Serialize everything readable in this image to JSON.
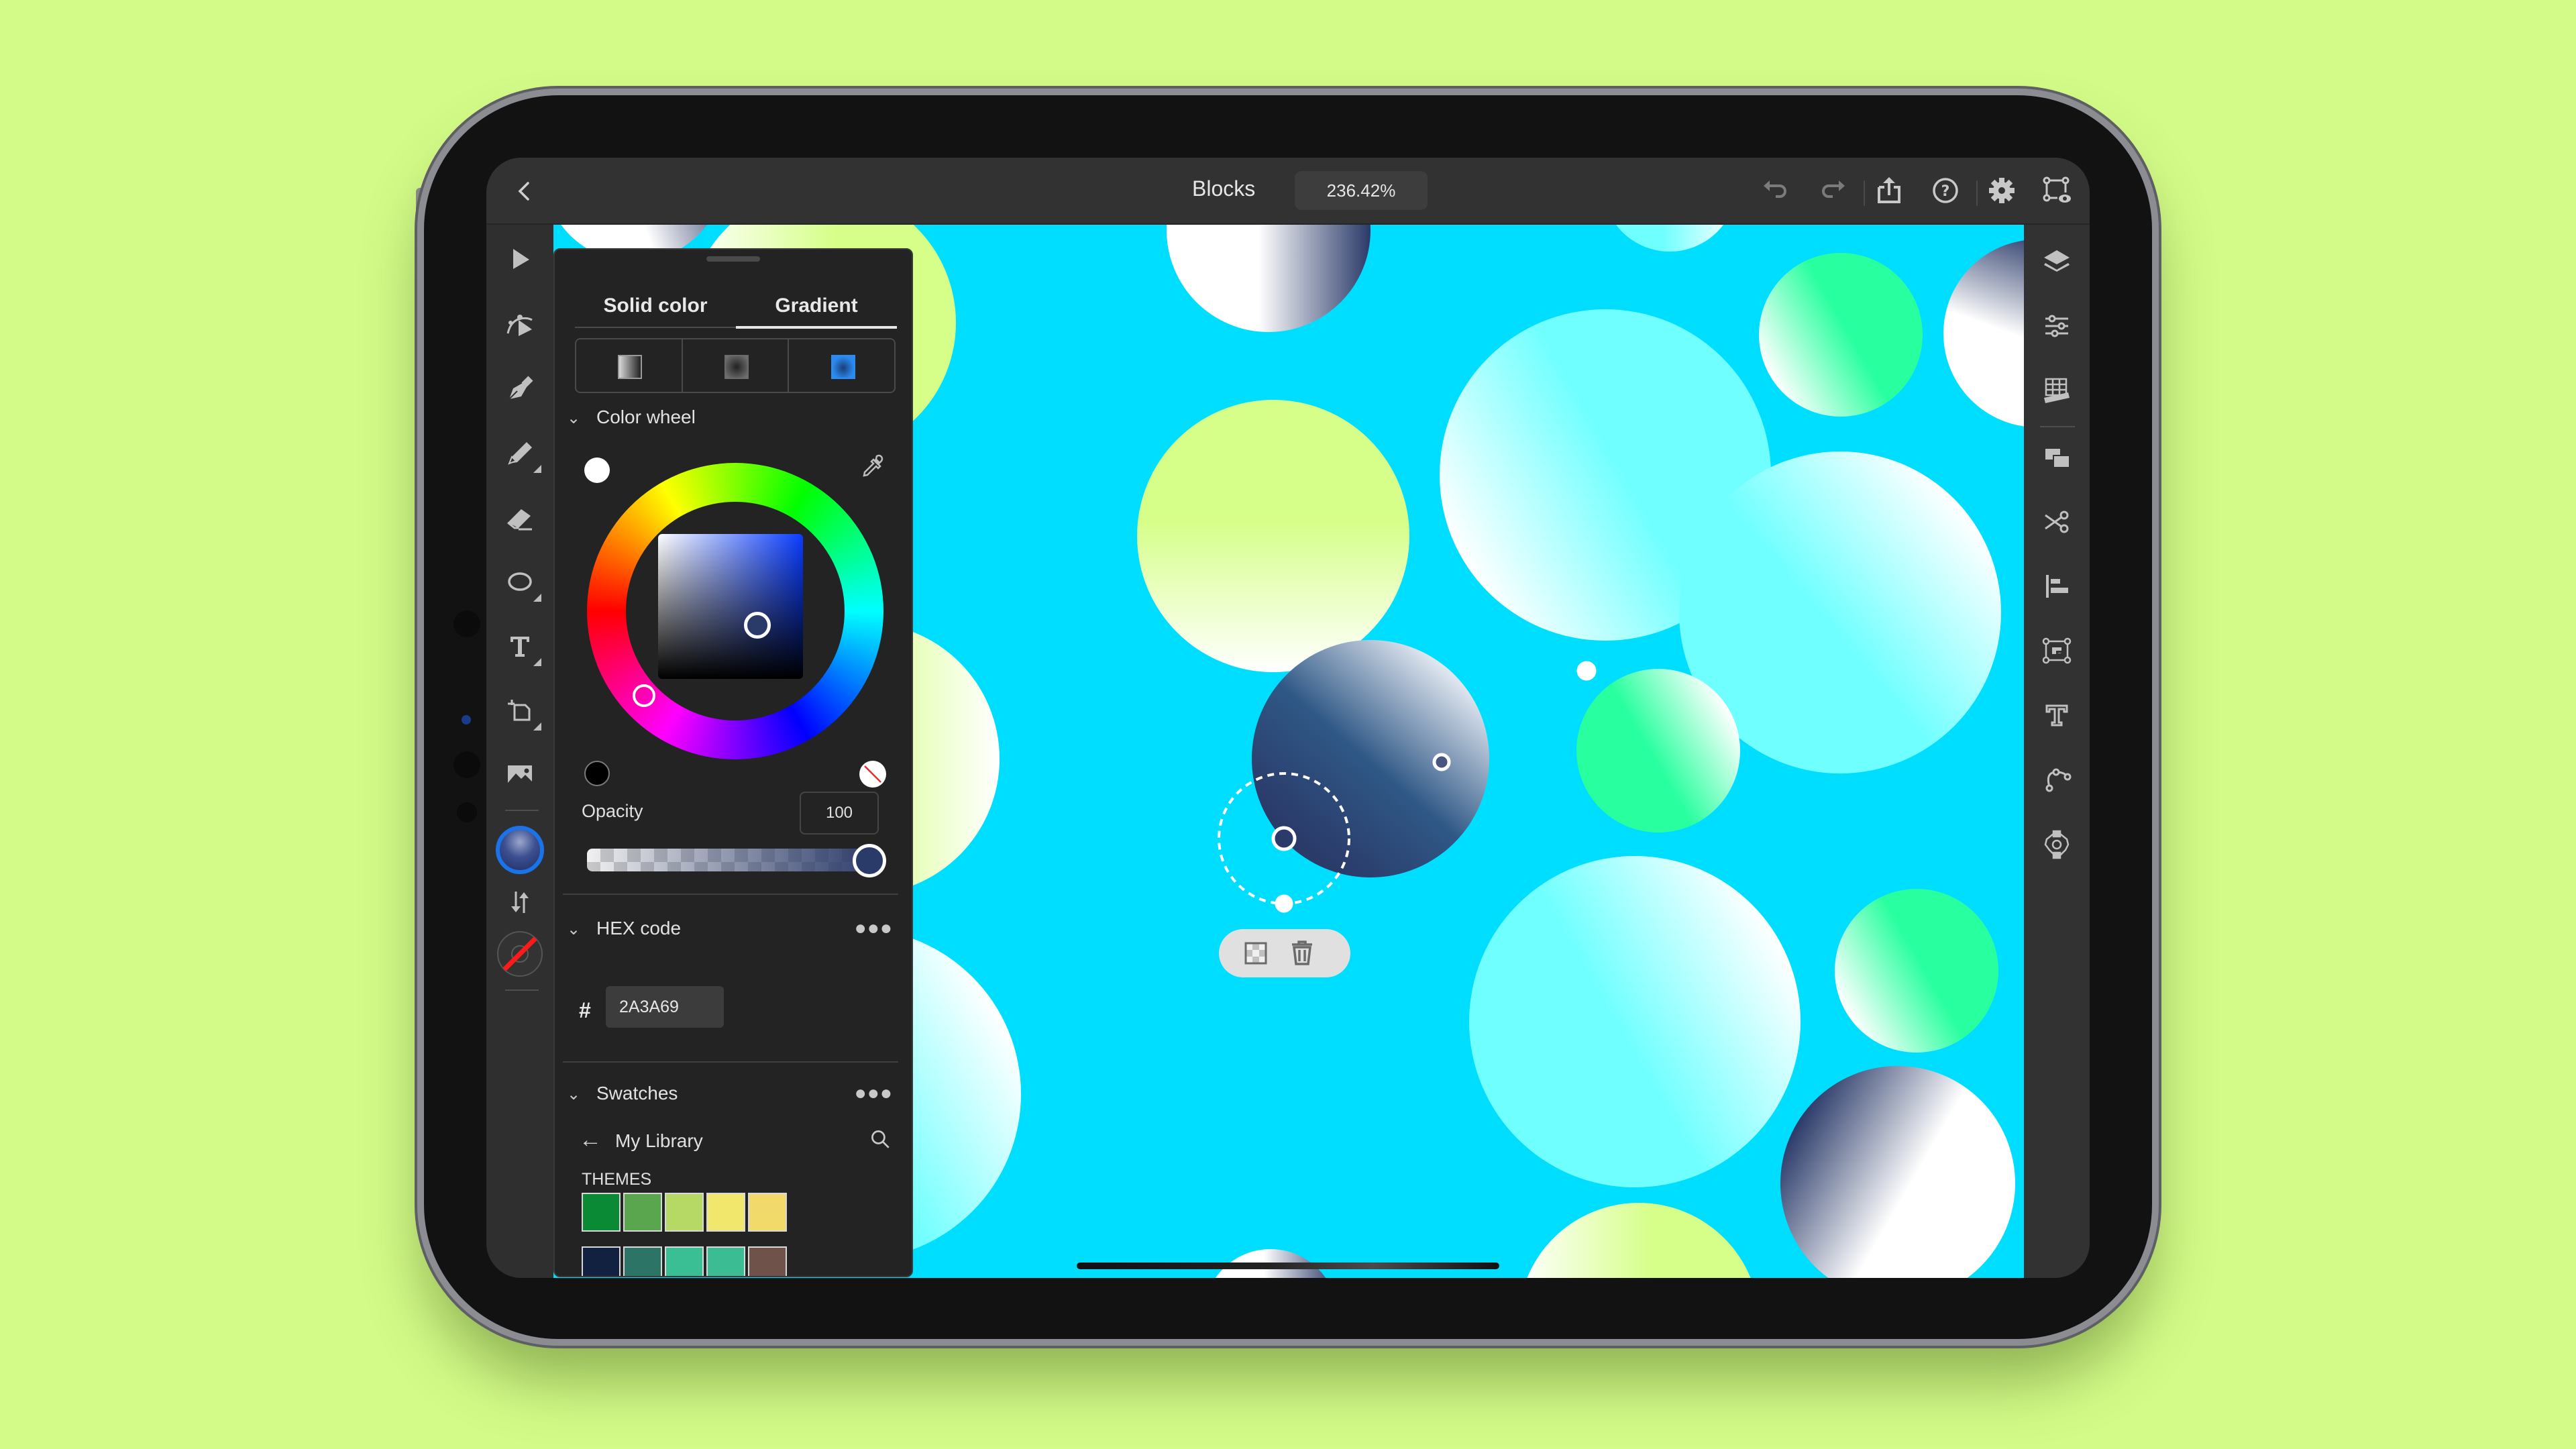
{
  "app": {
    "document_title": "Blocks",
    "zoom_level": "236.42%"
  },
  "topbar": {
    "back_icon": "chevron-left-icon",
    "actions": [
      {
        "name": "undo",
        "icon": "undo-icon"
      },
      {
        "name": "redo",
        "icon": "redo-icon"
      },
      {
        "name": "share",
        "icon": "share-icon"
      },
      {
        "name": "help",
        "icon": "help-icon"
      },
      {
        "name": "settings",
        "icon": "gear-icon"
      },
      {
        "name": "preview",
        "icon": "preview-icon"
      }
    ]
  },
  "left_toolbar": {
    "tools": [
      {
        "name": "selection",
        "icon": "arrow-select-icon"
      },
      {
        "name": "direct-selection",
        "icon": "direct-select-icon"
      },
      {
        "name": "pen",
        "icon": "pen-nib-icon"
      },
      {
        "name": "pencil",
        "icon": "pencil-icon"
      },
      {
        "name": "eraser",
        "icon": "eraser-icon"
      },
      {
        "name": "shape",
        "icon": "ellipse-icon"
      },
      {
        "name": "type",
        "icon": "type-icon"
      },
      {
        "name": "transform",
        "icon": "transform-icon"
      },
      {
        "name": "place-image",
        "icon": "image-icon"
      }
    ],
    "fill_color": "#2A3A69",
    "stroke": "none"
  },
  "right_toolbar": {
    "tools": [
      {
        "name": "layers",
        "icon": "layers-icon"
      },
      {
        "name": "properties",
        "icon": "sliders-icon"
      },
      {
        "name": "grid-rulers",
        "icon": "grid-ruler-icon"
      },
      {
        "name": "combine-shapes",
        "icon": "combine-shapes-icon"
      },
      {
        "name": "cut",
        "icon": "scissors-icon"
      },
      {
        "name": "align",
        "icon": "align-icon"
      },
      {
        "name": "image-trace",
        "icon": "image-trace-icon"
      },
      {
        "name": "type-options",
        "icon": "type-options-icon"
      },
      {
        "name": "path",
        "icon": "path-icon"
      },
      {
        "name": "repeat",
        "icon": "repeat-icon"
      }
    ]
  },
  "color_panel": {
    "tabs": [
      {
        "label": "Solid color",
        "active": false
      },
      {
        "label": "Gradient",
        "active": true
      }
    ],
    "gradient_types": [
      {
        "name": "linear",
        "selected": false
      },
      {
        "name": "radial",
        "selected": false
      },
      {
        "name": "freeform",
        "selected": true
      }
    ],
    "color_wheel": {
      "label": "Color wheel",
      "white_swatch": "#FFFFFF",
      "black_swatch": "#000000",
      "hue_deg": 228,
      "saturation": 0.6,
      "brightness": 0.41
    },
    "opacity": {
      "label": "Opacity",
      "value": "100",
      "fraction": 1.0
    },
    "hex": {
      "label": "HEX code",
      "prefix": "#",
      "value": "2A3A69"
    },
    "swatches": {
      "label": "Swatches",
      "library": "My Library",
      "themes_label": "THEMES",
      "themes": [
        [
          "#0A8A35",
          "#5AA64E",
          "#B6D966",
          "#F0E76C",
          "#F2DA6A"
        ],
        [
          "#12213F",
          "#2B7466",
          "#3ABF94",
          "#3CBC92",
          "#6F5249"
        ]
      ]
    }
  },
  "canvas": {
    "background": "#00DEFF",
    "fills": {
      "navy": [
        "#2A3A69",
        "#FFFFFF"
      ],
      "lime": [
        "#FFFFFF",
        "#D6FF8A"
      ],
      "aqua": [
        "#FFFFFF",
        "#70FFFF"
      ],
      "mint": [
        "#FFFFFF",
        "#28FF9E"
      ]
    },
    "context_menu": [
      {
        "name": "opacity",
        "icon": "checker-icon"
      },
      {
        "name": "delete",
        "icon": "trash-icon"
      }
    ]
  }
}
